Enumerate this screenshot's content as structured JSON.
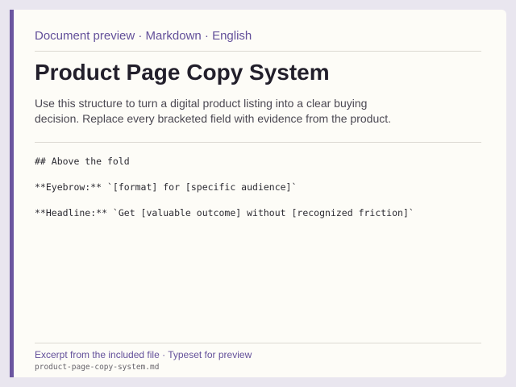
{
  "header": {
    "meta": "Document preview · Markdown · English"
  },
  "document": {
    "title": "Product Page Copy System",
    "lead": "Use this structure to turn a digital product listing into a clear buying decision. Replace every bracketed field with evidence from the product.",
    "code_lines": [
      "## Above the fold",
      "**Eyebrow:** `[format] for [specific audience]`",
      "**Headline:** `Get [valuable outcome] without [recognized friction]`"
    ]
  },
  "footer": {
    "caption": "Excerpt from the included file · Typeset for preview",
    "filename": "product-page-copy-system.md"
  },
  "colors": {
    "accent": "#6b56a0",
    "page_bg": "#e9e6ef",
    "card_bg": "#fdfcf7"
  }
}
